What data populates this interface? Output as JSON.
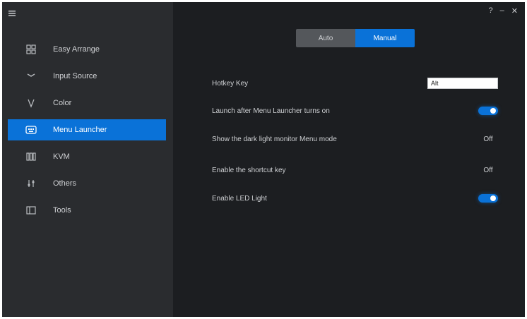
{
  "window": {
    "title": "",
    "controls": [
      "?",
      "–",
      "✕"
    ]
  },
  "sidebar": {
    "items": [
      {
        "label": "Easy Arrange",
        "icon": "grid-icon"
      },
      {
        "label": "Input Source",
        "icon": "input-icon"
      },
      {
        "label": "Color",
        "icon": "color-icon"
      },
      {
        "label": "Menu Launcher",
        "icon": "keyboard-icon",
        "active": true
      },
      {
        "label": "KVM",
        "icon": "kvm-icon"
      },
      {
        "label": "Others",
        "icon": "sliders-icon"
      },
      {
        "label": "Tools",
        "icon": "tools-icon"
      }
    ]
  },
  "tabs": [
    {
      "label": "Auto"
    },
    {
      "label": "Manual",
      "active": true
    }
  ],
  "settings": [
    {
      "label": "Hotkey Key",
      "control": "select",
      "value": "Alt"
    },
    {
      "label": "Launch after Menu Launcher turns on",
      "control": "toggle",
      "state": "on"
    },
    {
      "label": "Show the dark light monitor Menu mode",
      "control": "text",
      "value": "Off"
    },
    {
      "label": "Enable the shortcut key",
      "control": "text",
      "value": "Off"
    },
    {
      "label": "Enable LED Light",
      "control": "toggle",
      "state": "on"
    }
  ],
  "colors": {
    "accent": "#0a72d8",
    "sidebar_bg": "#2a2c2f",
    "main_bg": "#1c1e21"
  }
}
